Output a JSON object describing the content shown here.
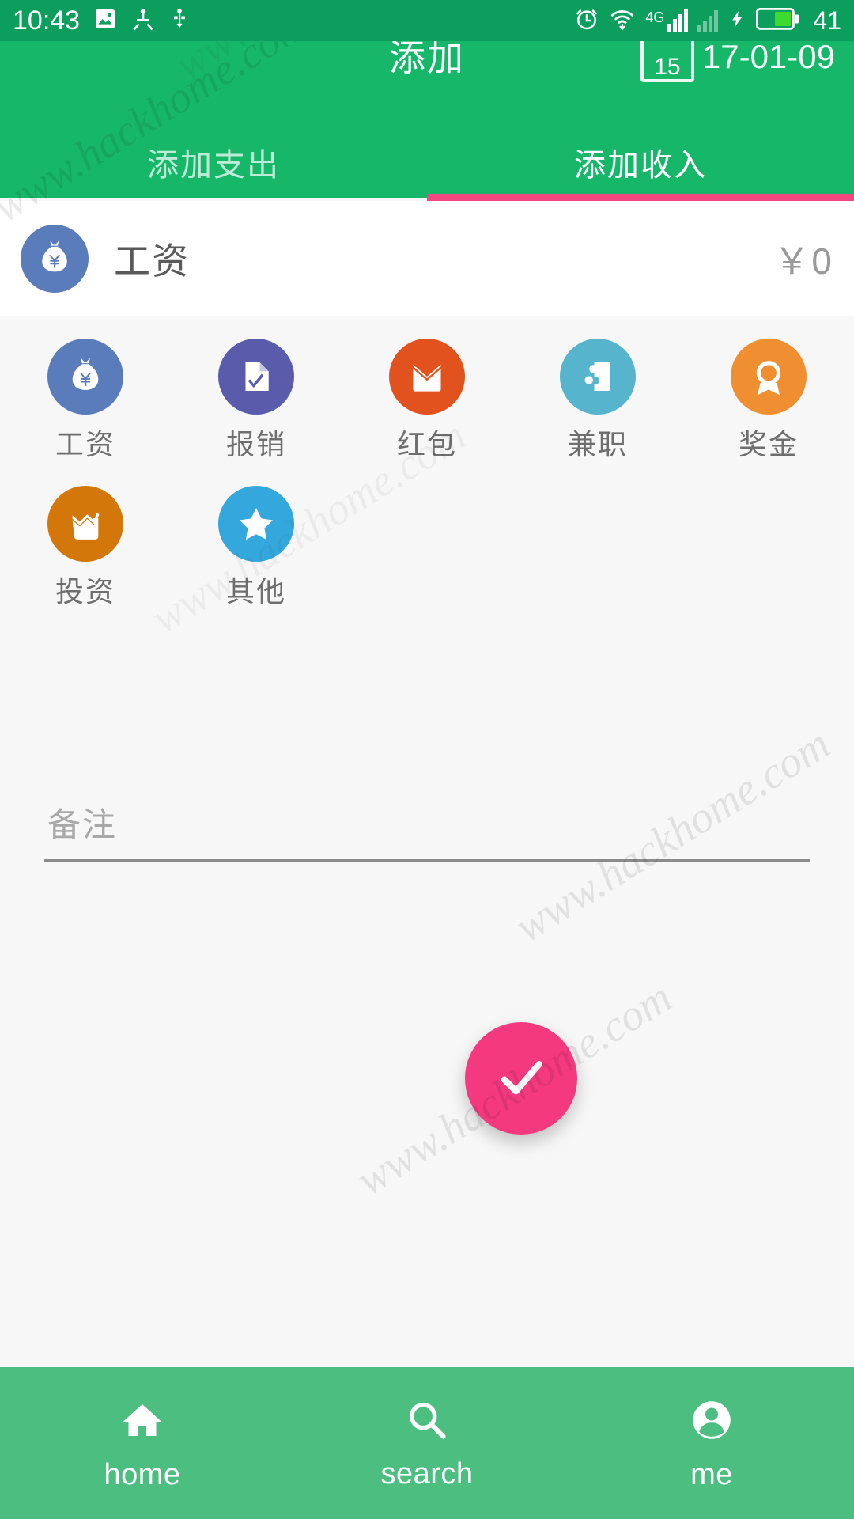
{
  "status_bar": {
    "time": "10:43",
    "battery_level": "41",
    "network": "4G",
    "icons": [
      "image-icon",
      "android-debug-icon",
      "usb-icon",
      "alarm-clock-icon",
      "wifi-icon",
      "signal-bars-icon",
      "signal-bars-secondary-icon",
      "charging-bolt-icon",
      "battery-icon"
    ]
  },
  "app_bar": {
    "title": "添加",
    "date": "17-01-09",
    "calendar_day": "15",
    "background_color": "#17b769"
  },
  "tabs": [
    {
      "label": "添加支出",
      "active": false
    },
    {
      "label": "添加收入",
      "active": true
    }
  ],
  "tab_indicator_color": "#f2487f",
  "selected": {
    "icon": "money-bag-icon",
    "icon_color": "#5b7cba",
    "label": "工资",
    "amount": "￥0"
  },
  "categories": [
    {
      "label": "工资",
      "icon": "money-bag-icon",
      "color": "#5b7cba"
    },
    {
      "label": "报销",
      "icon": "receipt-check-icon",
      "color": "#5a5cab"
    },
    {
      "label": "红包",
      "icon": "red-envelope-icon",
      "color": "#e1521f"
    },
    {
      "label": "兼职",
      "icon": "puzzle-piece-icon",
      "color": "#56b4cc"
    },
    {
      "label": "奖金",
      "icon": "medal-icon",
      "color": "#ef8f31"
    },
    {
      "label": "投资",
      "icon": "chart-growth-icon",
      "color": "#d4770b"
    },
    {
      "label": "其他",
      "icon": "star-icon",
      "color": "#34a8dd"
    }
  ],
  "note": {
    "placeholder": "备注",
    "value": ""
  },
  "fab": {
    "icon": "check-icon",
    "color": "#f4397e"
  },
  "bottom_nav": [
    {
      "label": "home",
      "icon": "home-icon"
    },
    {
      "label": "search",
      "icon": "search-icon"
    },
    {
      "label": "me",
      "icon": "person-icon"
    }
  ],
  "watermark": {
    "text": "www.hackhome.com"
  }
}
